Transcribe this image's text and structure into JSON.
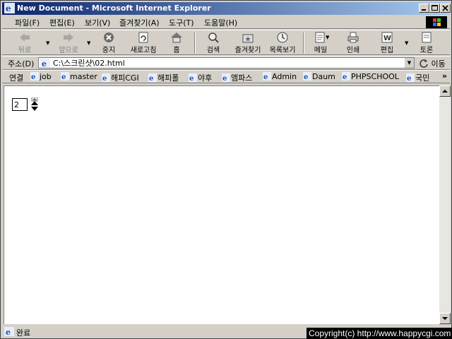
{
  "window": {
    "title": "New Document - Microsoft Internet Explorer"
  },
  "menu": {
    "items": [
      {
        "label": "파일(F)"
      },
      {
        "label": "편집(E)"
      },
      {
        "label": "보기(V)"
      },
      {
        "label": "즐겨찾기(A)"
      },
      {
        "label": "도구(T)"
      },
      {
        "label": "도움말(H)"
      }
    ]
  },
  "toolbar": {
    "back": "뒤로",
    "forward": "앞으로",
    "stop": "중지",
    "refresh": "새로고침",
    "home": "홈",
    "search": "검색",
    "favorites": "즐겨찾기",
    "history": "목록보기",
    "mail": "메일",
    "print": "인쇄",
    "edit": "편집",
    "discuss": "토론"
  },
  "address": {
    "label": "주소(D)",
    "value": "C:\\스크린샷\\02.html",
    "go": "이동"
  },
  "links": {
    "label": "연결",
    "items": [
      {
        "label": "job"
      },
      {
        "label": "master"
      },
      {
        "label": "해피CGI"
      },
      {
        "label": "해피폴"
      },
      {
        "label": "야후"
      },
      {
        "label": "엠파스"
      },
      {
        "label": "Admin"
      },
      {
        "label": "Daum"
      },
      {
        "label": "PHPSCHOOL"
      },
      {
        "label": "국민"
      }
    ]
  },
  "content": {
    "spin_value": "2"
  },
  "status": {
    "text": "완료"
  },
  "watermark": {
    "text": "Copyright(c) http://www.happycgi.com"
  },
  "colors": {
    "title_start": "#0a246a",
    "title_end": "#a6caf0",
    "chrome": "#d4d0c8"
  },
  "icons": [
    "ie-icon",
    "back-arrow-icon",
    "forward-arrow-icon",
    "stop-icon",
    "refresh-icon",
    "home-icon",
    "search-icon",
    "favorites-icon",
    "history-icon",
    "mail-icon",
    "print-icon",
    "edit-icon",
    "discuss-icon",
    "go-arrow-icon",
    "spin-up-icon",
    "spin-down-icon"
  ]
}
